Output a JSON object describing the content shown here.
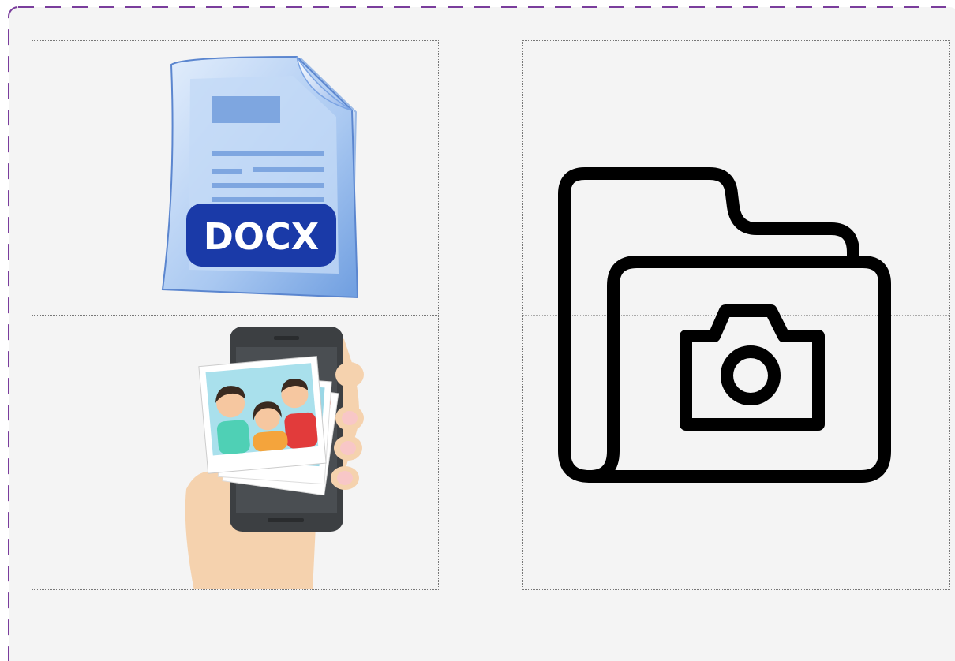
{
  "canvas": {
    "items": [
      {
        "name": "docx-file-image",
        "label": "DOCX"
      },
      {
        "name": "phone-photos-image"
      },
      {
        "name": "folder-camera-icon"
      }
    ]
  },
  "colors": {
    "border_accent": "#7a3d9c",
    "background": "#f4f4f4",
    "docx_badge": "#1a3aa8",
    "docx_page": "#b8d4f5"
  }
}
